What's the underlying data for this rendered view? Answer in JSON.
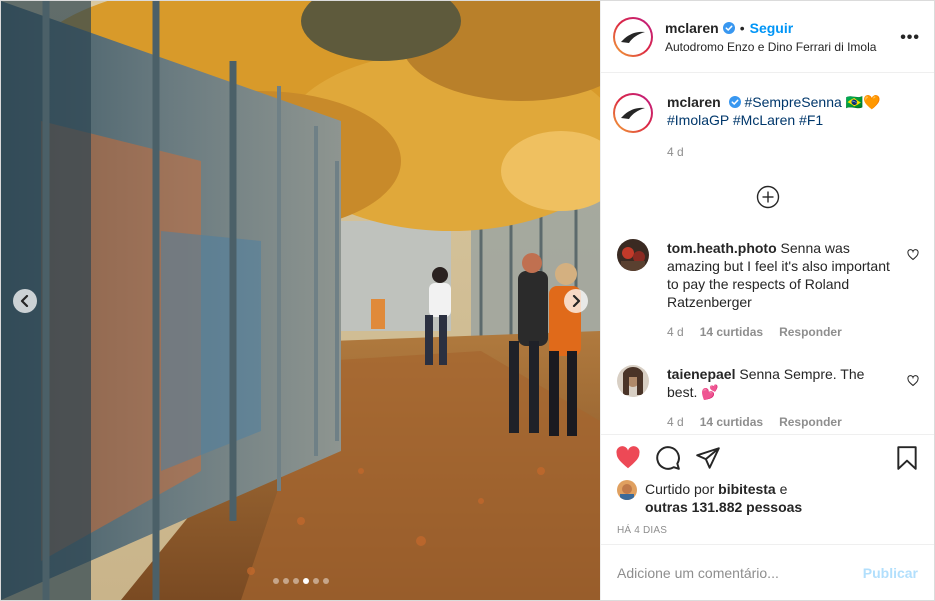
{
  "media": {
    "prev_icon": "chevron-left-icon",
    "next_icon": "chevron-right-icon",
    "slide_count": 6,
    "active_slide": 4
  },
  "header": {
    "username": "mclaren",
    "verified_icon": "verified-badge-icon",
    "bullet": "•",
    "follow_label": "Seguir",
    "location": "Autodromo Enzo e Dino Ferrari di Imola",
    "more_icon": "more-options-icon",
    "more_label": "•••"
  },
  "caption": {
    "username": "mclaren",
    "text_parts": [
      "#SempreSenna",
      " 🇧🇷🧡 ",
      "#ImolaGP",
      " ",
      "#McLaren",
      " ",
      "#F1"
    ],
    "time": "4 d"
  },
  "load_more_icon": "plus-circle-icon",
  "comments": [
    {
      "username": "tom.heath.photo",
      "text": "Senna was amazing but I feel it's also important to pay the respects of Roland Ratzenberger",
      "time": "4 d",
      "likes": "14 curtidas",
      "reply": "Responder"
    },
    {
      "username": "taienepael",
      "text": "Senna Sempre. The best. 💕",
      "time": "4 d",
      "likes": "14 curtidas",
      "reply": "Responder"
    }
  ],
  "actions": {
    "like_icon": "heart-filled-icon",
    "comment_icon": "comment-icon",
    "share_icon": "share-icon",
    "save_icon": "bookmark-icon",
    "like_color": "#ed4956"
  },
  "liked_by": {
    "prefix": "Curtido por ",
    "user": "bibitesta",
    "middle": " e",
    "others": "outras 131.882 pessoas"
  },
  "date": "HÁ 4 DIAS",
  "add_comment": {
    "placeholder": "Adicione um comentário...",
    "publish_label": "Publicar"
  }
}
